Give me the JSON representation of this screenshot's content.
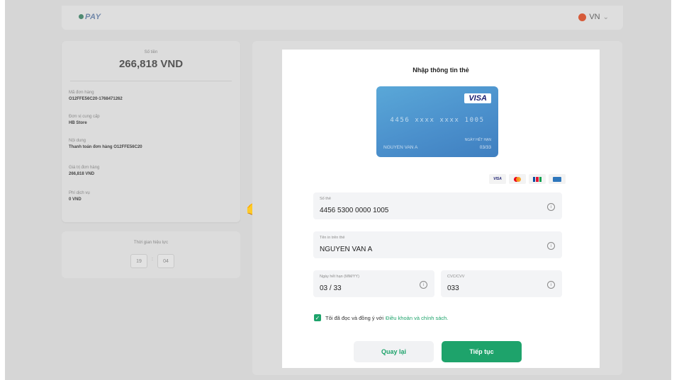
{
  "header": {
    "logo": "PAY",
    "language": "VN"
  },
  "order": {
    "amount_label": "Số tiền",
    "amount": "266,818 VND",
    "fields": [
      {
        "label": "Mã đơn hàng",
        "value": "O12FFE56C20-1768471262"
      },
      {
        "label": "Đơn vị cung cấp",
        "value": "HB Store"
      },
      {
        "label": "Nội dung",
        "value": "Thanh toán đơn hàng O12FFE56C20"
      },
      {
        "label": "Giá trị đơn hàng",
        "value": "266,818 VND"
      },
      {
        "label": "Phí dịch vụ",
        "value": "0 VND"
      }
    ]
  },
  "timer": {
    "label": "Thời gian hiệu lực",
    "minutes": "19",
    "seconds": "04",
    "separator": ":"
  },
  "pointer": {
    "icon": "pointing-hand-icon",
    "glyph": "👉"
  },
  "form": {
    "title": "Nhập thông tin thẻ",
    "card_preview": {
      "brand": "VISA",
      "number": "4456 xxxx xxxx 1005",
      "holder": "NGUYEN VAN A",
      "expiry_label": "NGÀY HẾT HẠN",
      "expiry": "03/33"
    },
    "accepted_brands": [
      "visa-logo",
      "mastercard-logo",
      "jcb-logo",
      "amex-logo"
    ],
    "visa_logo_text": "VISA",
    "card_number": {
      "label": "Số thẻ",
      "value": "4456 5300 0000 1005"
    },
    "card_name": {
      "label": "Tên in trên thẻ",
      "value": "NGUYEN VAN A"
    },
    "expiry": {
      "label": "Ngày hết hạn (MM/YY)",
      "value": "03 / 33"
    },
    "cvc": {
      "label": "CVC/CVV",
      "value": "033"
    },
    "info_glyph": "i",
    "terms": {
      "text": "Tôi đã đọc và đồng ý với",
      "link": "Điều khoản và chính sách.",
      "checked": true
    },
    "back_label": "Quay lại",
    "next_label": "Tiếp tục"
  },
  "colors": {
    "accent": "#1ea36b",
    "backdrop": "#d6d6d6",
    "card_gradient_start": "#5aa8d8",
    "card_gradient_end": "#3f7fc0"
  }
}
